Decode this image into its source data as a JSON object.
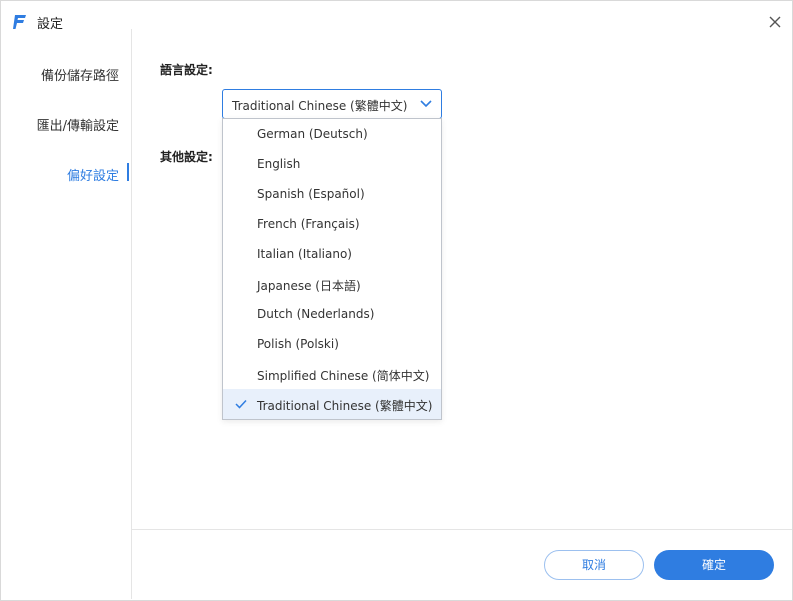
{
  "window": {
    "title": "設定",
    "logo_icon": "app-f-logo-icon",
    "close_icon": "close-icon"
  },
  "sidebar": {
    "items": [
      {
        "label": "備份儲存路徑",
        "active": false
      },
      {
        "label": "匯出/傳輸設定",
        "active": false
      },
      {
        "label": "偏好設定",
        "active": true
      }
    ]
  },
  "main": {
    "language_label": "語言設定:",
    "other_label": "其他設定:",
    "language_select": {
      "value": "Traditional Chinese (繁體中文)",
      "icon": "chevron-down-icon",
      "options": [
        {
          "label": "German (Deutsch)",
          "selected": false
        },
        {
          "label": "English",
          "selected": false
        },
        {
          "label": "Spanish (Español)",
          "selected": false
        },
        {
          "label": "French (Français)",
          "selected": false
        },
        {
          "label": "Italian (Italiano)",
          "selected": false
        },
        {
          "label": "Japanese (日本語)",
          "selected": false
        },
        {
          "label": "Dutch (Nederlands)",
          "selected": false
        },
        {
          "label": "Polish (Polski)",
          "selected": false
        },
        {
          "label": "Simplified Chinese (简体中文)",
          "selected": false
        },
        {
          "label": "Traditional Chinese (繁體中文)",
          "selected": true
        }
      ]
    }
  },
  "footer": {
    "cancel_label": "取消",
    "ok_label": "確定"
  },
  "colors": {
    "accent": "#2f7de1",
    "selected_bg": "#e8f0fb"
  }
}
